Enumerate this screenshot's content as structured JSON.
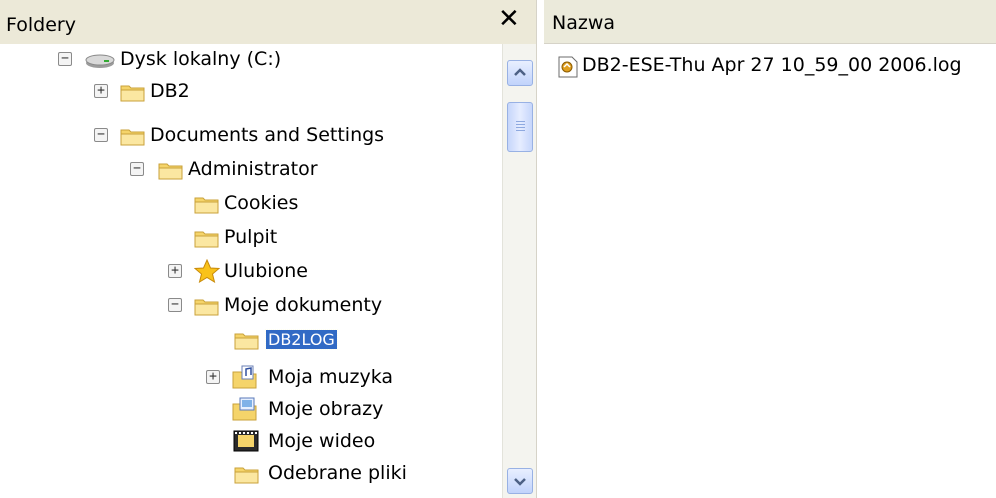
{
  "folders_pane": {
    "title": "Foldery",
    "close_glyph": "✕"
  },
  "tree": [
    {
      "label": "Dysk lokalny (C:)",
      "icon": "drive-icon",
      "expander": "−"
    },
    {
      "label": "DB2",
      "icon": "folder-icon",
      "expander": "+"
    },
    {
      "label": "Documents and Settings",
      "icon": "folder-icon",
      "expander": "−"
    },
    {
      "label": "Administrator",
      "icon": "folder-icon",
      "expander": "−"
    },
    {
      "label": "Cookies",
      "icon": "folder-icon",
      "expander": ""
    },
    {
      "label": "Pulpit",
      "icon": "folder-icon",
      "expander": ""
    },
    {
      "label": "Ulubione",
      "icon": "favorites-star-icon",
      "expander": "+"
    },
    {
      "label": "Moje dokumenty",
      "icon": "folder-icon",
      "expander": "−"
    },
    {
      "label": "DB2LOG",
      "icon": "folder-icon",
      "expander": "",
      "selected": true
    },
    {
      "label": "Moja muzyka",
      "icon": "music-folder-icon",
      "expander": "+"
    },
    {
      "label": "Moje obrazy",
      "icon": "pictures-folder-icon",
      "expander": ""
    },
    {
      "label": "Moje wideo",
      "icon": "video-folder-icon",
      "expander": ""
    },
    {
      "label": "Odebrane pliki",
      "icon": "folder-icon",
      "expander": ""
    }
  ],
  "files_pane": {
    "column_name": "Nazwa",
    "files": [
      {
        "name": "DB2-ESE-Thu Apr 27 10_59_00 2006.log",
        "icon": "log-file-icon"
      }
    ]
  },
  "colors": {
    "header_bg": "#ece9d8",
    "selection": "#316ac5",
    "folder": "#f5d46a"
  }
}
